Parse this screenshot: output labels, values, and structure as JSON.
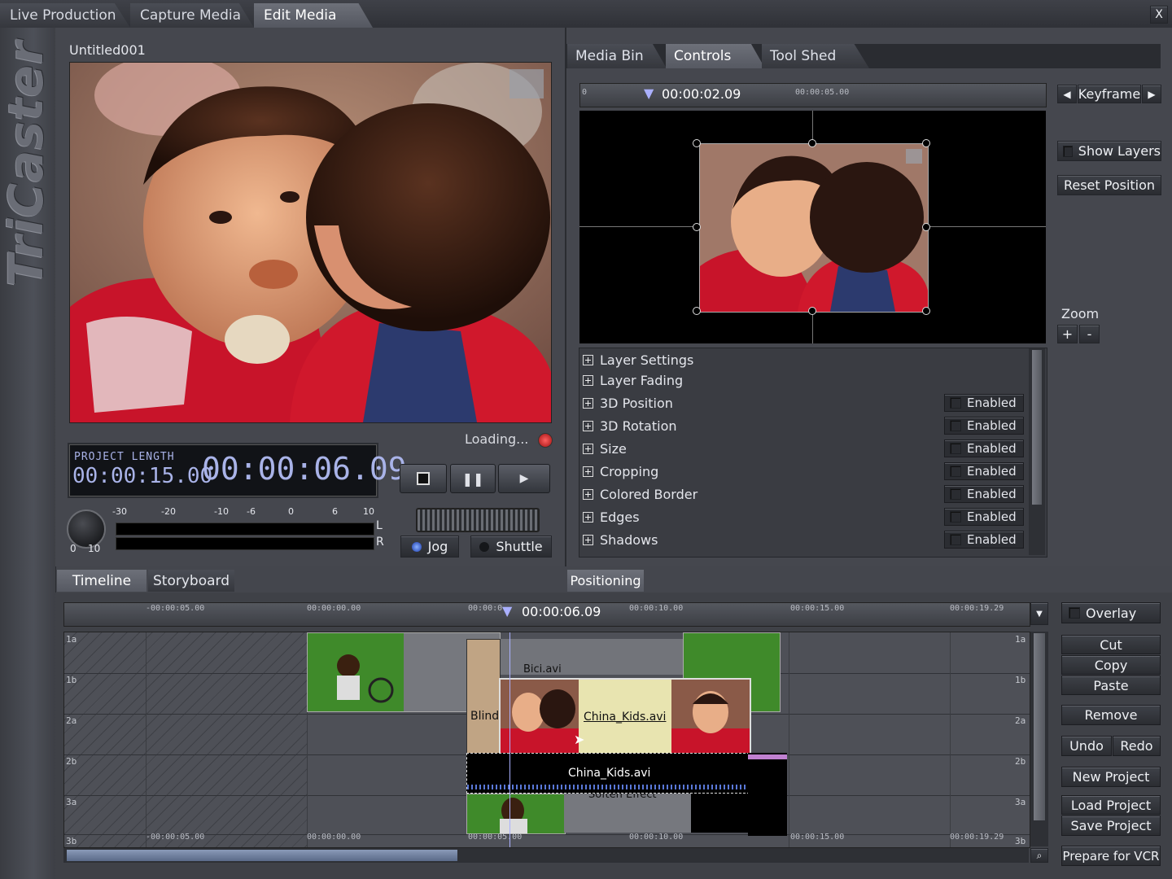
{
  "top_tabs": [
    "Live Production",
    "Capture Media",
    "Edit Media"
  ],
  "close_label": "X",
  "logo": "TriCaster",
  "project_name": "Untitled001",
  "status": "Loading...",
  "project_length_label": "PROJECT LENGTH",
  "project_length": "00:00:15.00",
  "current_timecode": "00:00:06.09",
  "meter_scale": [
    "-30",
    "-20",
    "-10",
    "-6",
    "0",
    "6",
    "10"
  ],
  "meter_channels": [
    "L",
    "R"
  ],
  "knob_min": "0",
  "knob_max": "10",
  "jog_label": "Jog",
  "shuttle_label": "Shuttle",
  "panel_tabs": [
    "Media Bin",
    "Controls",
    "Tool Shed"
  ],
  "controls": {
    "ruler_start": "0",
    "timecode": "00:00:02.09",
    "ruler_mark": "00:00:05.00",
    "keyframe_label": "Keyframe",
    "show_layers": "Show Layers",
    "reset_position": "Reset Position",
    "zoom_label": "Zoom",
    "zoom_in": "+",
    "zoom_out": "-",
    "properties": [
      {
        "label": "Layer Settings",
        "enabled": ""
      },
      {
        "label": "Layer Fading",
        "enabled": ""
      },
      {
        "label": "3D Position",
        "enabled": "Enabled"
      },
      {
        "label": "3D Rotation",
        "enabled": "Enabled"
      },
      {
        "label": "Size",
        "enabled": "Enabled"
      },
      {
        "label": "Cropping",
        "enabled": "Enabled"
      },
      {
        "label": "Colored Border",
        "enabled": "Enabled"
      },
      {
        "label": "Edges",
        "enabled": "Enabled"
      },
      {
        "label": "Shadows",
        "enabled": "Enabled"
      }
    ],
    "positioning_tab": "Positioning"
  },
  "timeline_tabs": [
    "Timeline",
    "Storyboard"
  ],
  "timeline": {
    "ruler": [
      "-00:00:05.00",
      "00:00:00.00",
      "00:00:0",
      "00:00:10.00",
      "00:00:15.00",
      "00:00:19.29"
    ],
    "bottom_ruler": [
      "-00:00:05.00",
      "00:00:00.00",
      "00:00:05.00",
      "00:00:10.00",
      "00:00:15.00",
      "00:00:19.29"
    ],
    "playhead": "00:00:06.09",
    "tracks": [
      "1a",
      "1b",
      "2a",
      "2b",
      "3a",
      "3b"
    ],
    "clip_title": "China_Kids.avi",
    "audio_title": "China_Kids.avi",
    "blinds_label": "Blinds",
    "bici_label": "Bici.avi",
    "soften_label": "Soften Effect"
  },
  "actions": {
    "overlay": "Overlay",
    "cut": "Cut",
    "copy": "Copy",
    "paste": "Paste",
    "remove": "Remove",
    "undo": "Undo",
    "redo": "Redo",
    "new_project": "New Project",
    "load_project": "Load Project",
    "save_project": "Save Project",
    "prepare_vcr": "Prepare for VCR"
  }
}
